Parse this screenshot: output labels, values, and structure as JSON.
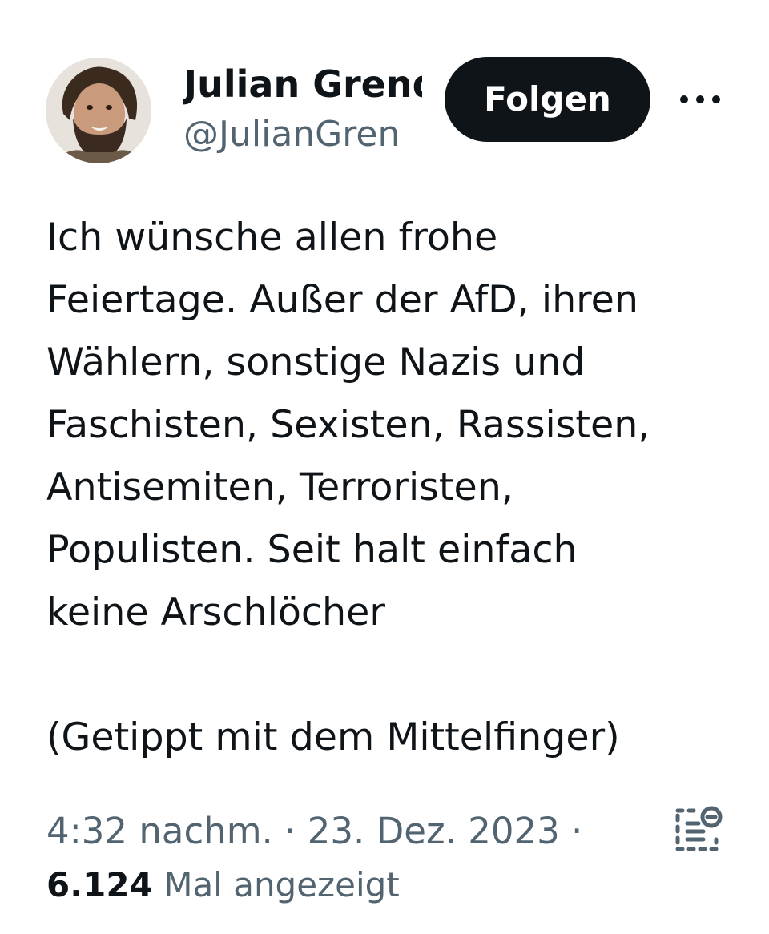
{
  "author": {
    "display_name": "Julian Grend",
    "handle": "@JulianGren",
    "avatar_icon": "bearded-man-avatar"
  },
  "actions": {
    "follow_label": "Folgen",
    "more_icon": "more-horizontal-icon"
  },
  "tweet": {
    "text": "Ich wünsche allen frohe\nFeiertage. Außer der AfD, ihren\nWählern, sonstige Nazis und\nFaschisten, Sexisten, Rassisten,\nAntisemiten, Terroristen,\nPopulisten. Seit halt einfach\nkeine Arschlöcher\n\n(Getippt mit dem Mittelfinger)"
  },
  "meta": {
    "time": "4:32 nachm.",
    "separator": " · ",
    "date": "23. Dez. 2023",
    "trailing_separator": " ·",
    "views_count": "6.124",
    "views_label": " Mal angezeigt",
    "analytics_icon": "analytics-icon"
  },
  "colors": {
    "text_primary": "#0f1419",
    "text_secondary": "#536471",
    "button_bg": "#0f1419",
    "button_text": "#ffffff"
  }
}
